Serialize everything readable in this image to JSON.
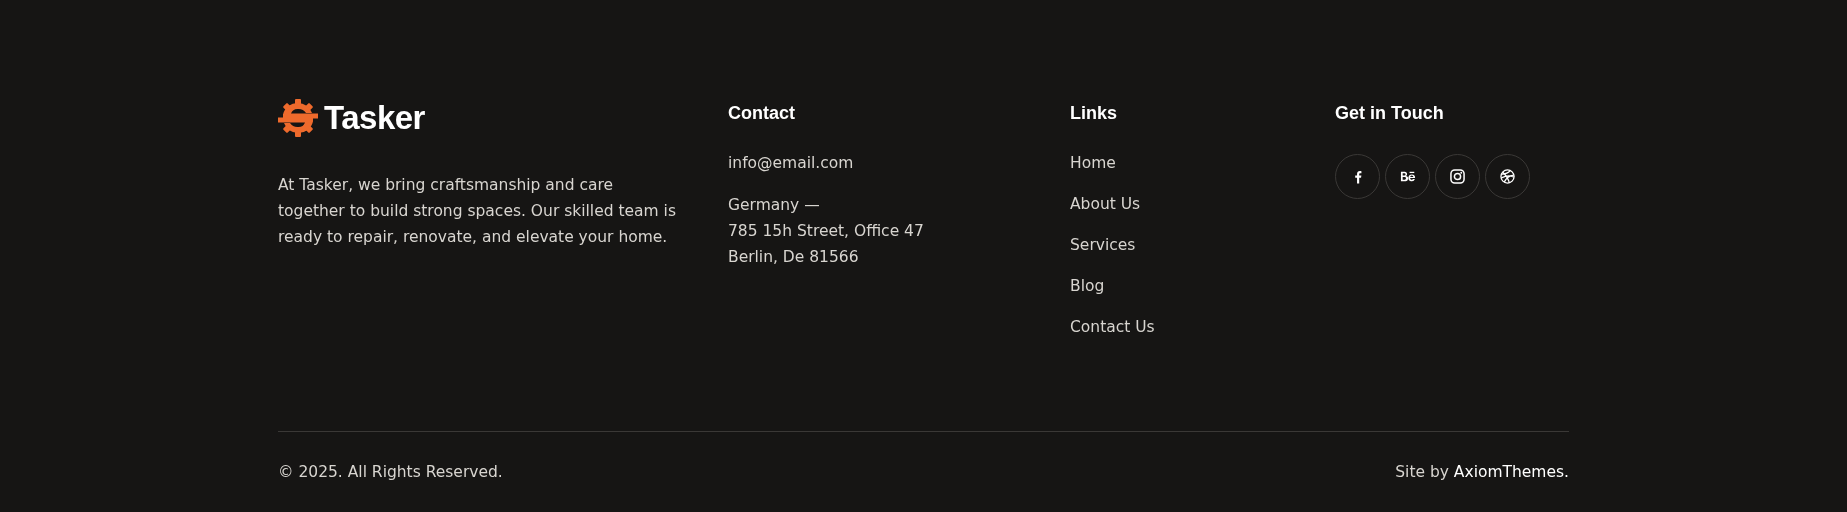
{
  "brand": {
    "name": "Tasker",
    "description": "At Tasker, we bring craftsmanship and care together to build strong spaces. Our skilled team is ready to repair, renovate, and elevate your home."
  },
  "contact": {
    "heading": "Contact",
    "email": "info@email.com",
    "address": [
      "Germany —",
      "785 15h Street, Office 47",
      "Berlin, De 81566"
    ]
  },
  "links": {
    "heading": "Links",
    "items": [
      "Home",
      "About Us",
      "Services",
      "Blog",
      "Contact Us"
    ]
  },
  "social": {
    "heading": "Get in Touch",
    "items": [
      {
        "kind": "facebook"
      },
      {
        "kind": "behance"
      },
      {
        "kind": "instagram"
      },
      {
        "kind": "dribbble"
      }
    ]
  },
  "bottom": {
    "copyright": "© 2025. All Rights Reserved.",
    "credit": "Site by **AxiomThemes.**"
  }
}
